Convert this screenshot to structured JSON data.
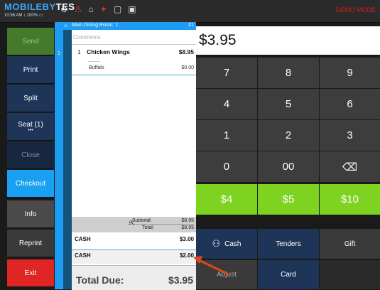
{
  "app": {
    "brand_part1": "MOBILEBY",
    "brand_part2": "TES",
    "status_bar": "10:56 AM ↕ 100% ▭",
    "demo_mode": "DEMO MODE"
  },
  "top_icons": [
    "settings-icon",
    "alert-icon",
    "lock-icon",
    "restaurant-icon",
    "chat-icon",
    "message-icon"
  ],
  "left_buttons": [
    {
      "label": "Send",
      "color": "#457a2c",
      "text_color": "#9cc78a"
    },
    {
      "label": "Print",
      "color": "#1e3558"
    },
    {
      "label": "Split",
      "color": "#1e3558"
    },
    {
      "label": "Seat (1)",
      "color": "#1e3558",
      "dots": "•••"
    },
    {
      "label": "Close",
      "color": "#17273f",
      "text_color": "#7c8aa0"
    },
    {
      "label": "Checkout",
      "color": "#1aa0f0"
    },
    {
      "label": "Info",
      "color": "#4a4a4a"
    },
    {
      "label": "Reprint",
      "color": "#3a3a3a"
    },
    {
      "label": "Exit",
      "color": "#e02525"
    }
  ],
  "order": {
    "room": "Main Dining Room: 1",
    "tab": "#1",
    "strip_number": "1",
    "comments_placeholder": "Comments",
    "item": {
      "qty": "1",
      "name": "Chicken Wings",
      "price": "$8.95"
    },
    "modifier_sep": "----------",
    "modifier": {
      "name": "Buffalo",
      "price": "$0.00"
    },
    "subtotal_label": "Subtotal:",
    "subtotal_value": "$8.95",
    "total_label": "Total:",
    "total_value": "$8.95",
    "payments": [
      {
        "name": "CASH",
        "amount": "$3.00"
      },
      {
        "name": "CASH",
        "amount": "$2.00"
      }
    ],
    "total_due_label": "Total Due:",
    "total_due_value": "$3.95"
  },
  "keypad": {
    "display": "$3.95",
    "rows": [
      [
        "7",
        "8",
        "9"
      ],
      [
        "4",
        "5",
        "6"
      ],
      [
        "1",
        "2",
        "3"
      ],
      [
        "0",
        "00",
        "⌫"
      ]
    ],
    "quick_cash": [
      "$4",
      "$5",
      "$10"
    ],
    "bottom_row1": [
      "Cash",
      "Tenders",
      "Gift"
    ],
    "bottom_row2": [
      "Adjust",
      "Card",
      ""
    ]
  }
}
